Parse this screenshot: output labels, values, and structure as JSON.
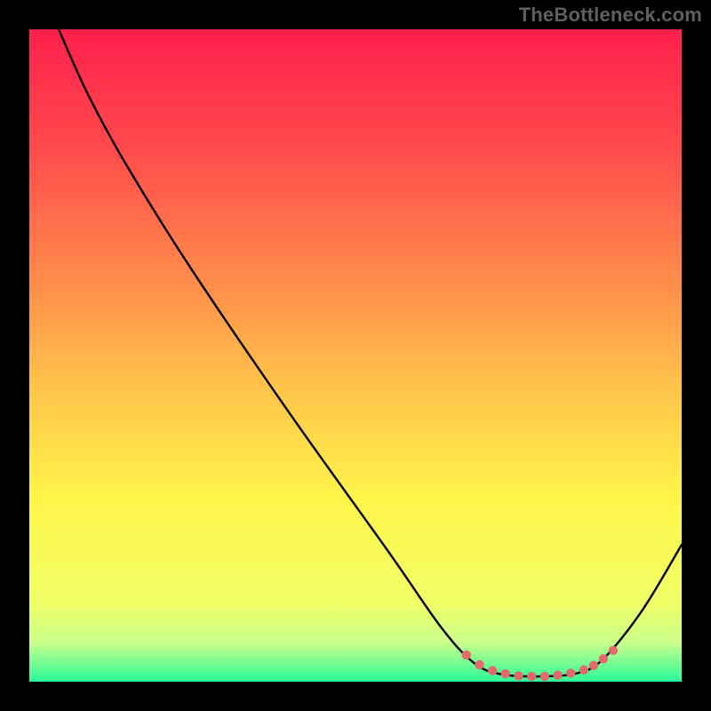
{
  "watermark": "TheBottleneck.com",
  "chart_data": {
    "type": "line",
    "title": "",
    "xlabel": "",
    "ylabel": "",
    "xlim": [
      0,
      100
    ],
    "ylim": [
      0,
      100
    ],
    "gradient_stops": [
      {
        "offset": 0,
        "color": "#ff1f4b"
      },
      {
        "offset": 18,
        "color": "#ff4a4d"
      },
      {
        "offset": 38,
        "color": "#ff8a4a"
      },
      {
        "offset": 55,
        "color": "#ffc44a"
      },
      {
        "offset": 72,
        "color": "#fff54a"
      },
      {
        "offset": 88,
        "color": "#f0ff66"
      },
      {
        "offset": 94,
        "color": "#c9ff8a"
      },
      {
        "offset": 100,
        "color": "#2bfb9a"
      }
    ],
    "series": [
      {
        "name": "bottleneck-curve",
        "points": [
          {
            "x": 4.5,
            "y": 100.0
          },
          {
            "x": 9.0,
            "y": 90.0
          },
          {
            "x": 15.0,
            "y": 79.0
          },
          {
            "x": 25.0,
            "y": 63.0
          },
          {
            "x": 40.0,
            "y": 41.0
          },
          {
            "x": 55.0,
            "y": 20.0
          },
          {
            "x": 63.0,
            "y": 8.5
          },
          {
            "x": 68.0,
            "y": 3.0
          },
          {
            "x": 72.0,
            "y": 1.2
          },
          {
            "x": 78.0,
            "y": 0.8
          },
          {
            "x": 84.0,
            "y": 1.3
          },
          {
            "x": 88.0,
            "y": 3.5
          },
          {
            "x": 94.0,
            "y": 11.0
          },
          {
            "x": 100.0,
            "y": 21.0
          }
        ]
      }
    ],
    "markers": [
      {
        "x": 67.0,
        "y": 4.1
      },
      {
        "x": 69.0,
        "y": 2.6
      },
      {
        "x": 71.0,
        "y": 1.7
      },
      {
        "x": 73.0,
        "y": 1.2
      },
      {
        "x": 75.0,
        "y": 0.9
      },
      {
        "x": 77.0,
        "y": 0.8
      },
      {
        "x": 79.0,
        "y": 0.8
      },
      {
        "x": 81.0,
        "y": 1.0
      },
      {
        "x": 83.0,
        "y": 1.3
      },
      {
        "x": 85.0,
        "y": 1.8
      },
      {
        "x": 86.5,
        "y": 2.5
      },
      {
        "x": 88.0,
        "y": 3.5
      },
      {
        "x": 89.5,
        "y": 4.8
      }
    ],
    "marker_color": "#e36a6a",
    "curve_color": "#000000"
  }
}
